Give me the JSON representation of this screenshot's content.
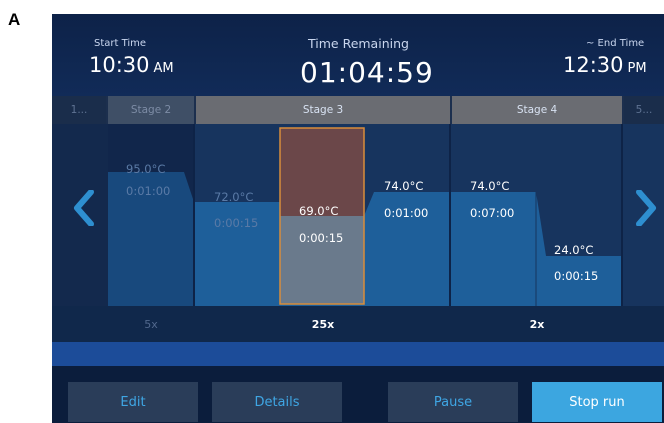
{
  "figure": {
    "label": "A"
  },
  "header": {
    "start_time_label": "Start Time",
    "start_time_value": "10:30",
    "start_time_suffix": "AM",
    "time_remaining_label": "Time Remaining",
    "time_remaining_value": "01:04:59",
    "end_time_label": "~ End Time",
    "end_time_value": "12:30",
    "end_time_suffix": "PM"
  },
  "stages": {
    "prev_stub": "1...",
    "stage2": "Stage 2",
    "stage3": "Stage 3",
    "stage4": "Stage 4",
    "next_stub": "5..."
  },
  "steps": [
    {
      "temp": "95.0°C",
      "time": "0:01:00",
      "state": "past"
    },
    {
      "temp": "72.0°C",
      "time": "0:00:15",
      "state": "past"
    },
    {
      "temp": "69.0°C",
      "time": "0:00:15",
      "state": "current"
    },
    {
      "temp": "74.0°C",
      "time": "0:01:00",
      "state": "upcoming"
    },
    {
      "temp": "74.0°C",
      "time": "0:07:00",
      "state": "upcoming"
    },
    {
      "temp": "24.0°C",
      "time": "0:00:15",
      "state": "upcoming"
    }
  ],
  "cycles": {
    "stage2": "5x",
    "stage3": "25x",
    "stage4": "2x"
  },
  "buttons": {
    "edit": "Edit",
    "details": "Details",
    "pause": "Pause",
    "stop": "Stop run"
  },
  "colors": {
    "screen_bg": "#0e2347",
    "accent": "#3ca6e0",
    "current_step_fill": "#7a4b45",
    "current_step_border": "#d98d3b",
    "profile_fill": "#1e5f9a"
  }
}
